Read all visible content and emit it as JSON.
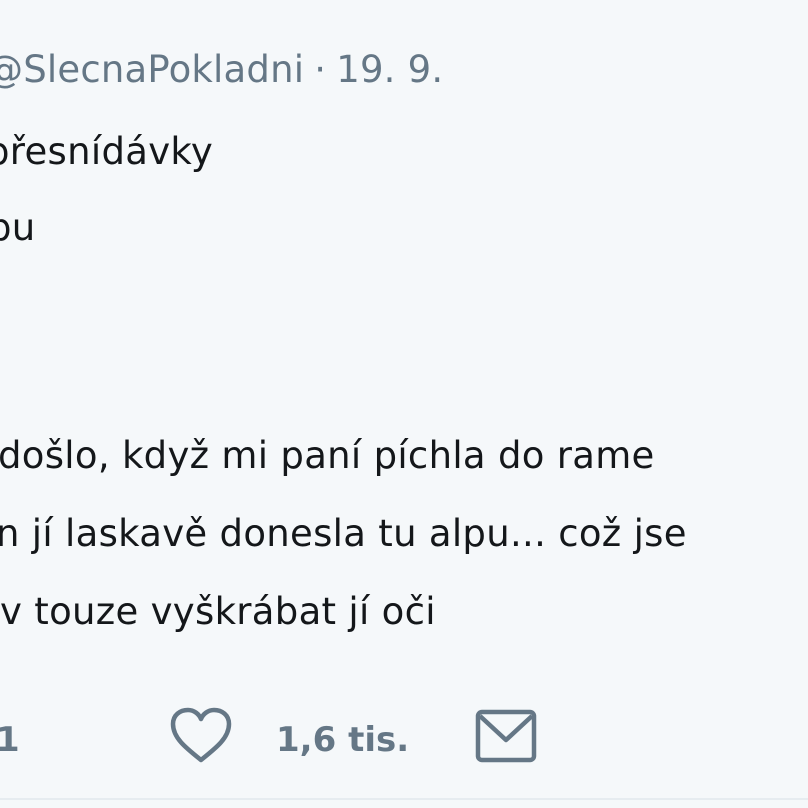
{
  "tweet": {
    "header": {
      "handle": "@SlecnaPokladni",
      "separator": "·",
      "date": "19. 9."
    },
    "lines": [
      "přesnídávky",
      "pu",
      "došlo, když mi paní píchla do rame",
      "n jí laskavě donesla tu alpu... což jse",
      " v touze vyškrábat jí oči"
    ],
    "actions": {
      "reply_count": "1",
      "like_icon": "heart-icon",
      "like_count": "1,6 tis.",
      "dm_icon": "envelope-icon"
    }
  }
}
